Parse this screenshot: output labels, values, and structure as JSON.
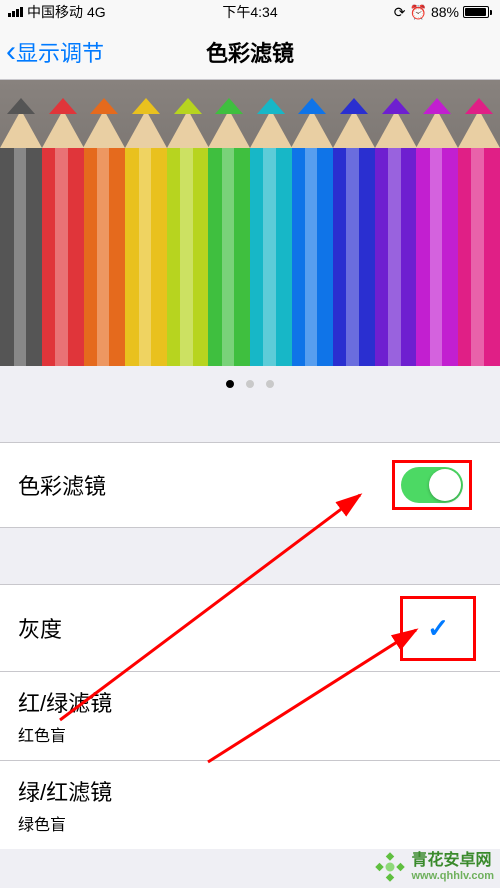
{
  "status": {
    "carrier": "中国移动",
    "network": "4G",
    "time": "下午4:34",
    "battery_pct": "88%"
  },
  "nav": {
    "back_label": "显示调节",
    "title": "色彩滤镜"
  },
  "pencil_colors": [
    "#555555",
    "#e0353a",
    "#e56a1d",
    "#e9c11e",
    "#b7d41f",
    "#3fbf3f",
    "#17b7c7",
    "#0f74e8",
    "#2a2fd0",
    "#6e1fd0",
    "#c21fd0",
    "#e01f86"
  ],
  "carousel": {
    "pages": 3,
    "active_index": 0
  },
  "toggle": {
    "label": "色彩滤镜",
    "on": true
  },
  "options": [
    {
      "title": "灰度",
      "subtitle": "",
      "selected": true
    },
    {
      "title": "红/绿滤镜",
      "subtitle": "红色盲",
      "selected": false
    },
    {
      "title": "绿/红滤镜",
      "subtitle": "绿色盲",
      "selected": false
    }
  ],
  "watermark": {
    "line1": "青花安卓网",
    "line2": "www.qhhlv.com"
  },
  "annotations": {
    "highlight_toggle": true,
    "highlight_check": true,
    "arrow_color": "#ff0000"
  }
}
